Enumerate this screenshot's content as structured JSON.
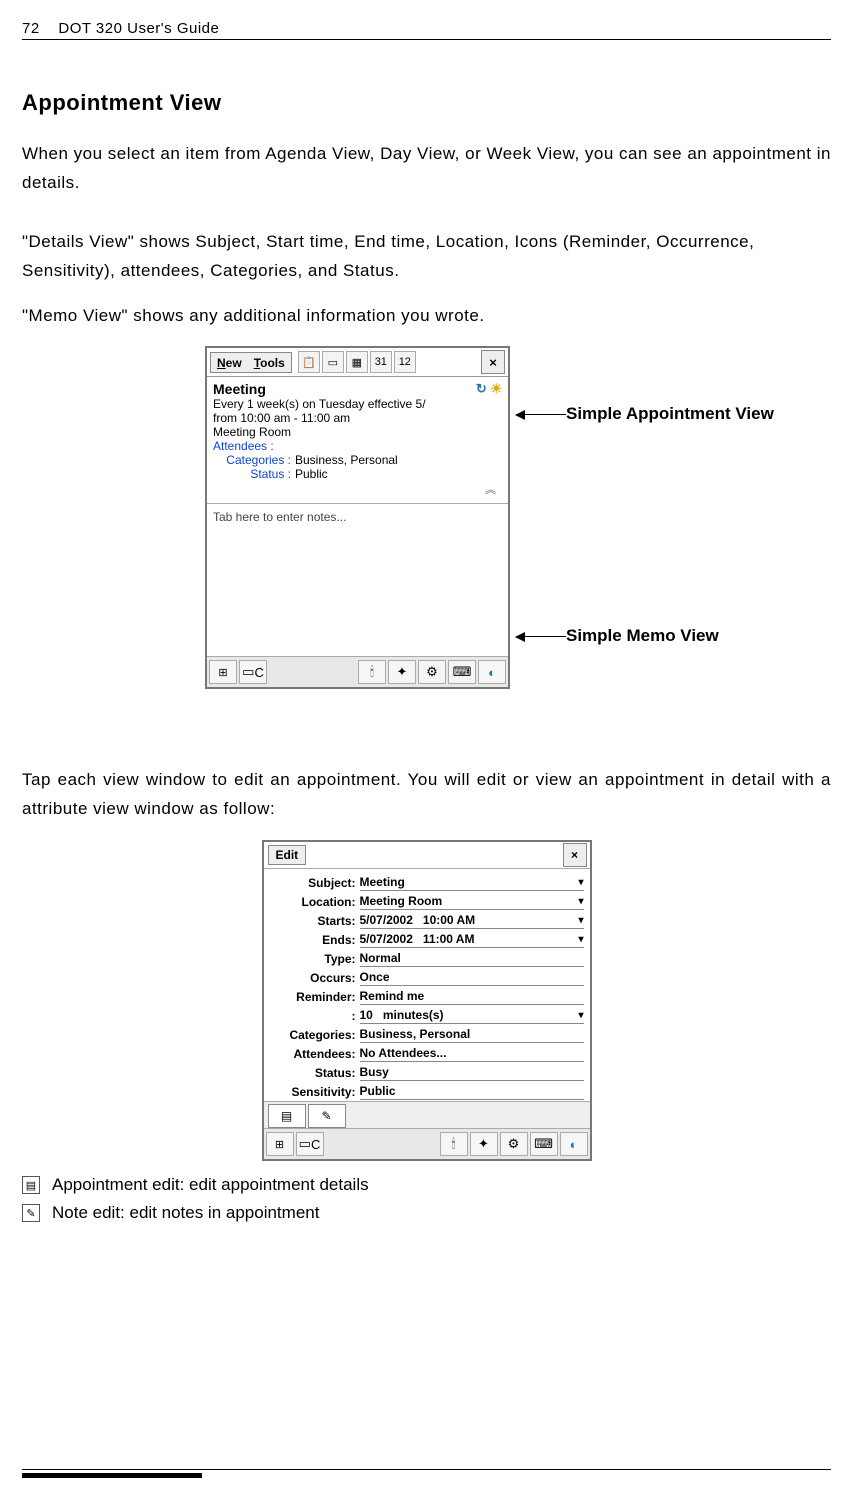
{
  "header": {
    "page_num": "72",
    "title": "DOT 320 User's Guide"
  },
  "section_title": "Appointment View",
  "para1": "When you select an item from Agenda View, Day View, or Week View, you can see an appointment in details.",
  "para2": "\"Details View\" shows Subject, Start time, End time, Location, Icons (Reminder, Occurrence, Sensitivity), attendees, Categories, and Status.",
  "para3": "\"Memo View\" shows any additional information you wrote.",
  "shot1": {
    "menu_new": "New",
    "menu_tools": "Tools",
    "close_x": "×",
    "appt_title": "Meeting",
    "recurrence": "Every 1 week(s) on Tuesday effective  5/",
    "time_range": "from 10:00 am - 11:00 am",
    "location": "Meeting Room",
    "attendees_label": "Attendees :",
    "categories_label": "Categories :",
    "categories_value": "Business, Personal",
    "status_label": "Status :",
    "status_value": "Public",
    "memo_placeholder": "Tab here to enter notes...",
    "callout1": "Simple Appointment View",
    "callout2": "Simple Memo View",
    "tb_icon_labels": [
      "31",
      "12"
    ],
    "task_letters": "C"
  },
  "para4": "Tap each view window to edit an appointment. You will edit or view an appointment in detail with a attribute view window as follow:",
  "shot2": {
    "edit_menu": "Edit",
    "close_x": "×",
    "rows": [
      {
        "label": "Subject:",
        "value": "Meeting",
        "drop": true
      },
      {
        "label": "Location:",
        "value": "Meeting Room",
        "drop": true
      },
      {
        "label": "Starts:",
        "value": "5/07/2002",
        "value2": "10:00 AM",
        "drop": true
      },
      {
        "label": "Ends:",
        "value": "5/07/2002",
        "value2": "11:00 AM",
        "drop": true
      },
      {
        "label": "Type:",
        "value": "Normal"
      },
      {
        "label": "Occurs:",
        "value": "Once"
      },
      {
        "label": "Reminder:",
        "value": "Remind me"
      },
      {
        "label": ":",
        "value": "10",
        "value2": "minutes(s)",
        "drop": true
      },
      {
        "label": "Categories:",
        "value": "Business, Personal"
      },
      {
        "label": "Attendees:",
        "value": "No Attendees..."
      },
      {
        "label": "Status:",
        "value": "Busy"
      },
      {
        "label": "Sensitivity:",
        "value": "Public"
      }
    ]
  },
  "legend": {
    "appt_edit": "Appointment edit: edit appointment details",
    "note_edit": "Note edit: edit notes in appointment"
  }
}
